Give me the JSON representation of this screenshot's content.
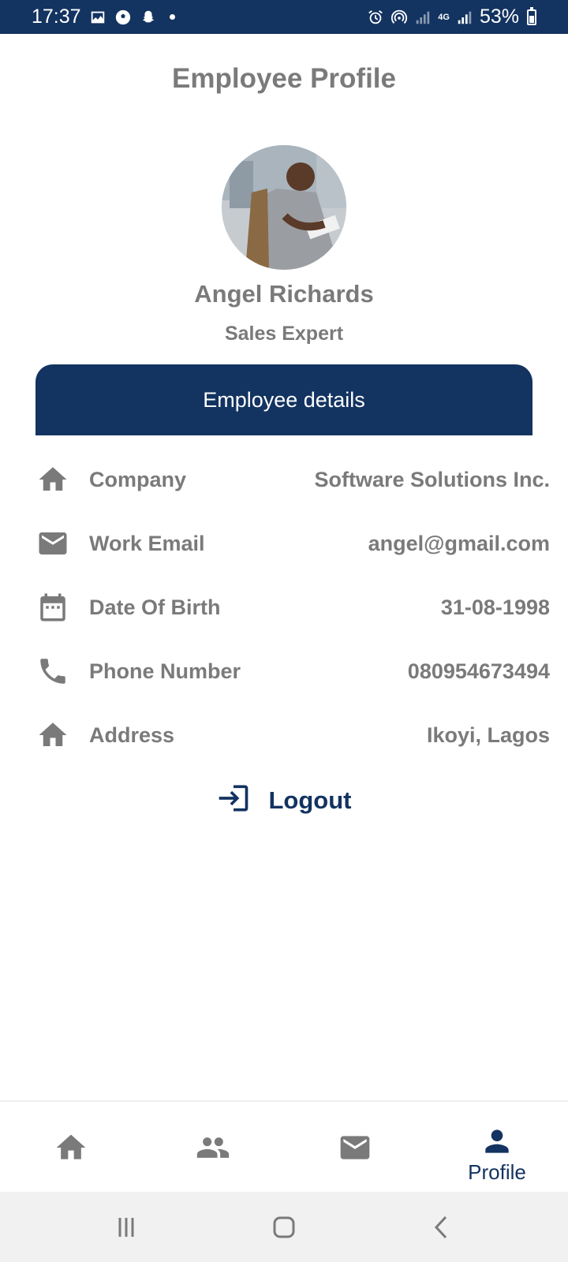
{
  "status_bar": {
    "time": "17:37",
    "battery": "53%",
    "network": "4G",
    "icons_left": [
      "gallery-icon",
      "soccer-ball-icon",
      "snapchat-icon",
      "notification-dot"
    ],
    "icons_right": [
      "alarm-icon",
      "hotspot-icon",
      "signal-icon",
      "signal-4g-icon",
      "battery-icon"
    ]
  },
  "header": {
    "title": "Employee Profile"
  },
  "profile": {
    "name": "Angel Richards",
    "role": "Sales Expert"
  },
  "details": {
    "header_label": "Employee details",
    "rows": [
      {
        "icon": "home-icon",
        "label": "Company",
        "value": "Software Solutions Inc."
      },
      {
        "icon": "mail-icon",
        "label": "Work Email",
        "value": "angel@gmail.com"
      },
      {
        "icon": "calendar-icon",
        "label": "Date Of Birth",
        "value": "31-08-1998"
      },
      {
        "icon": "phone-icon",
        "label": "Phone Number",
        "value": "080954673494"
      },
      {
        "icon": "home-icon",
        "label": "Address",
        "value": "Ikoyi, Lagos"
      }
    ]
  },
  "logout": {
    "label": "Logout"
  },
  "bottom_nav": {
    "items": [
      {
        "icon": "home-icon",
        "label": ""
      },
      {
        "icon": "people-icon",
        "label": ""
      },
      {
        "icon": "mail-icon",
        "label": ""
      },
      {
        "icon": "person-icon",
        "label": "Profile",
        "active": true
      }
    ]
  },
  "colors": {
    "primary": "#133361",
    "text_gray": "#7a7a7a",
    "background": "#ffffff",
    "system_bar": "#f1f1f1"
  }
}
